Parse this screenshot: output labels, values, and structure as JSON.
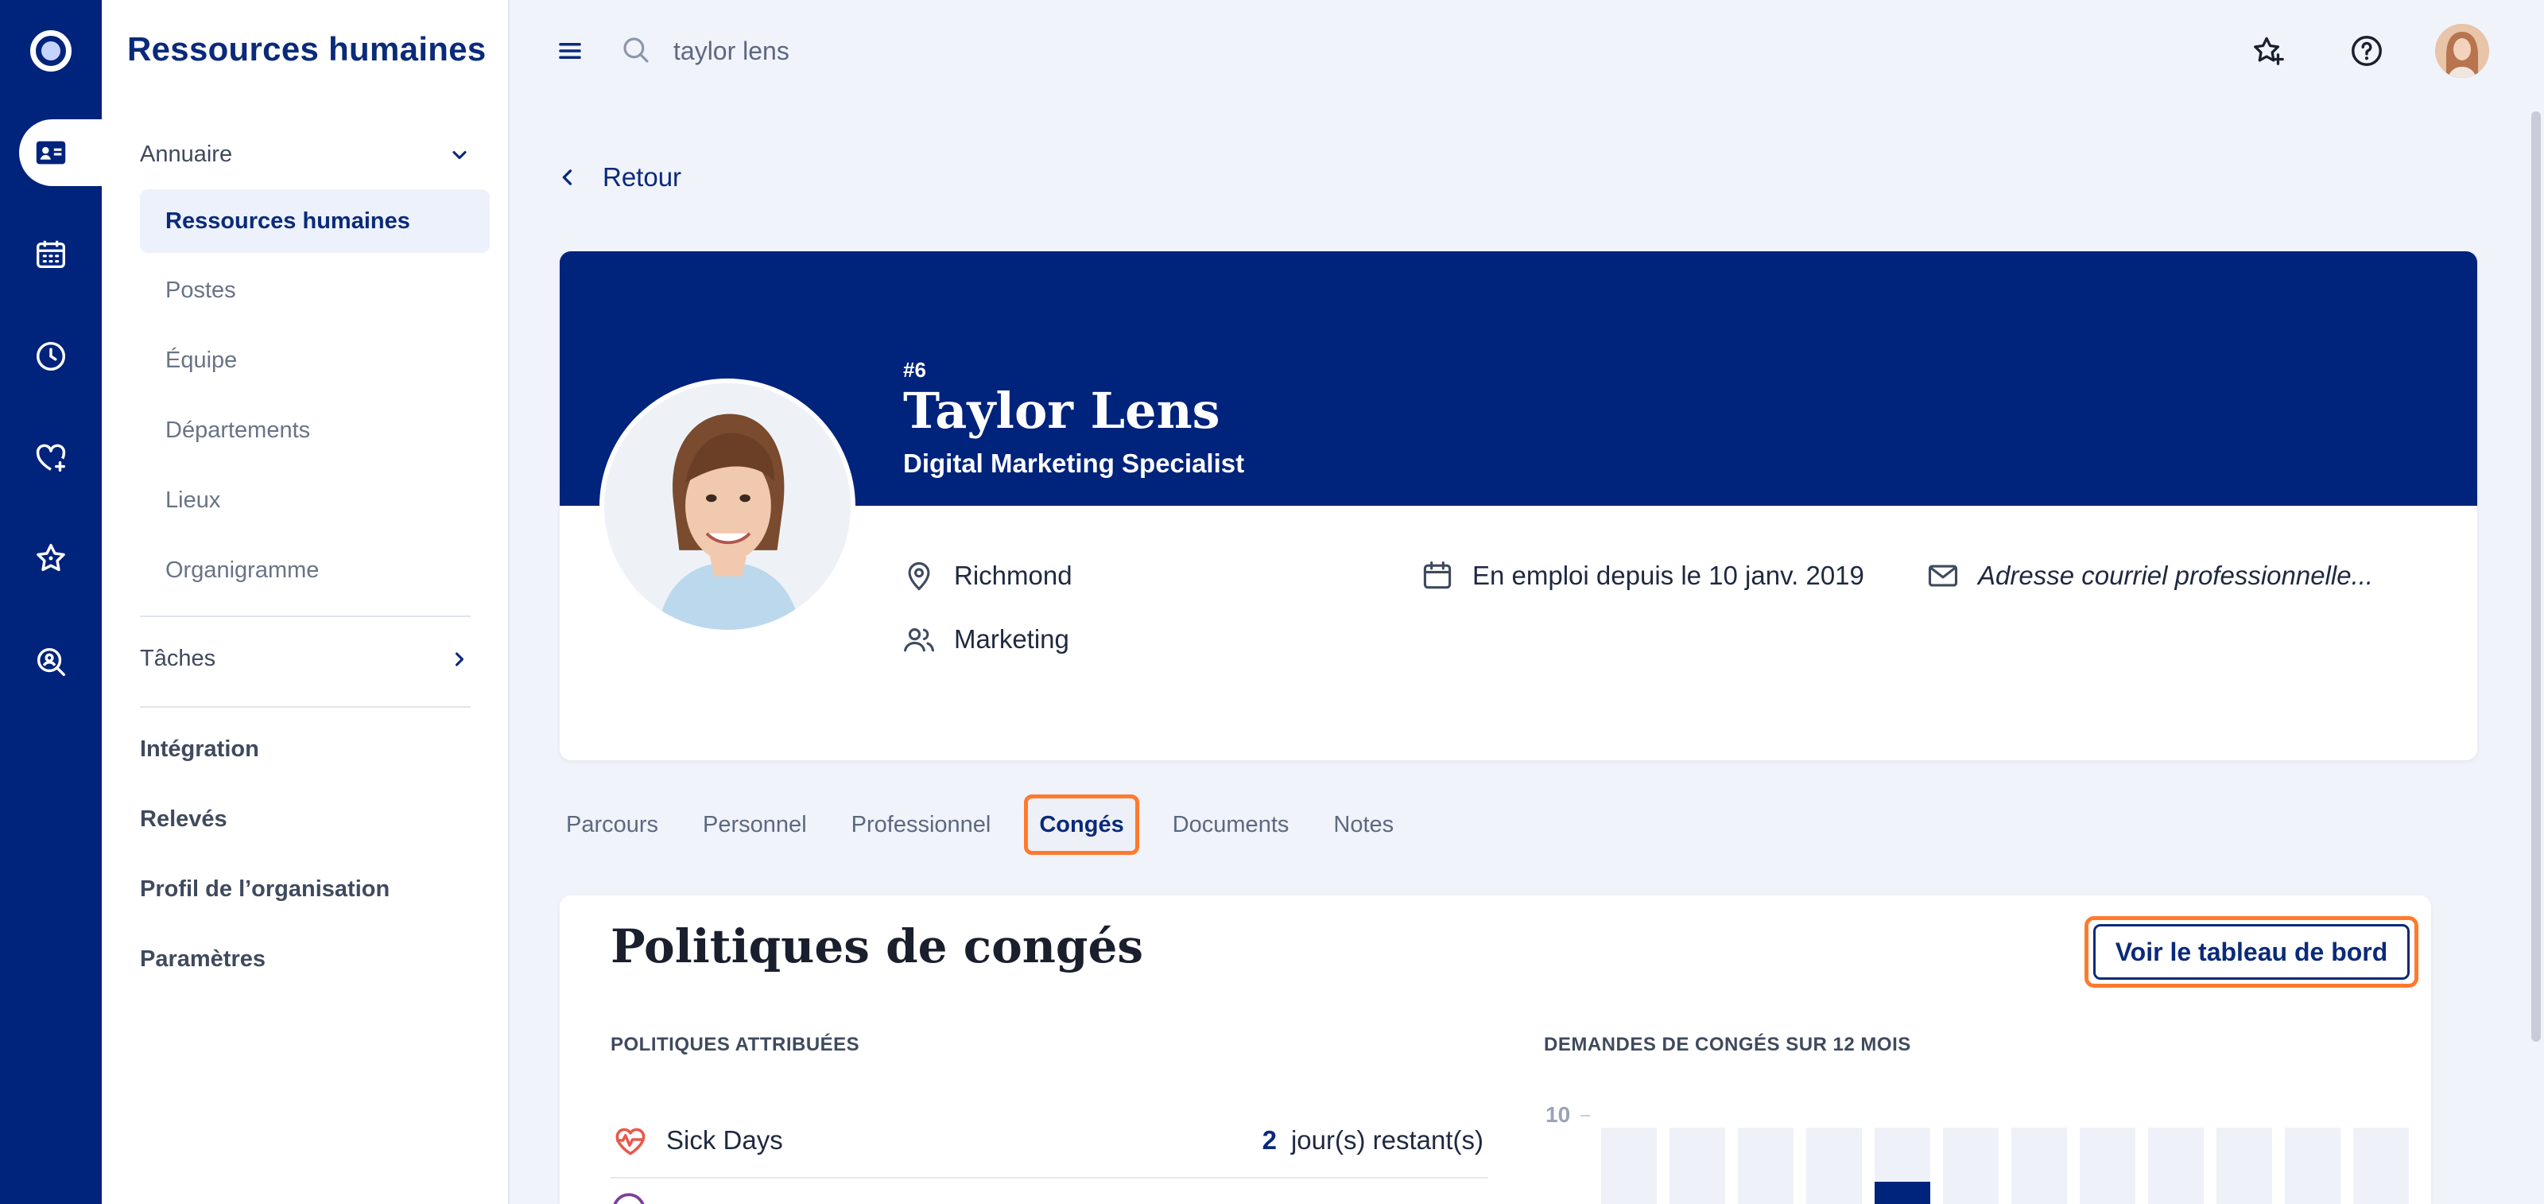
{
  "app": {
    "title": "Ressources humaines"
  },
  "search": {
    "value": "taylor lens"
  },
  "sidebar": {
    "groups": [
      {
        "label": "Annuaire"
      },
      {
        "label": "Tâches"
      }
    ],
    "directory_items": [
      {
        "label": "Ressources humaines",
        "active": true
      },
      {
        "label": "Postes"
      },
      {
        "label": "Équipe"
      },
      {
        "label": "Départements"
      },
      {
        "label": "Lieux"
      },
      {
        "label": "Organigramme"
      }
    ],
    "top_items": [
      {
        "label": "Intégration"
      },
      {
        "label": "Relevés"
      },
      {
        "label": "Profil de l’organisation"
      },
      {
        "label": "Paramètres"
      }
    ]
  },
  "rail_icons": [
    "logo-icon",
    "id-card-icon",
    "calendar-icon",
    "clock-icon",
    "heart-plus-icon",
    "star-icon",
    "search-person-icon"
  ],
  "back": {
    "label": "Retour"
  },
  "profile": {
    "id": "#6",
    "name": "Taylor Lens",
    "role": "Digital Marketing Specialist",
    "location": "Richmond",
    "department": "Marketing",
    "employed_since": "En emploi depuis le 10 janv. 2019",
    "email_placeholder": "Adresse courriel professionnelle..."
  },
  "tabs": [
    {
      "label": "Parcours"
    },
    {
      "label": "Personnel"
    },
    {
      "label": "Professionnel"
    },
    {
      "label": "Congés",
      "active": true
    },
    {
      "label": "Documents"
    },
    {
      "label": "Notes"
    }
  ],
  "policies": {
    "title": "Politiques de congés",
    "dashboard_button": "Voir le tableau de bord",
    "assigned_label": "POLITIQUES ATTRIBUÉES",
    "chart_label": "DEMANDES DE CONGÉS SUR 12 MOIS",
    "items": [
      {
        "name": "Sick Days",
        "count": "2",
        "unit": "jour(s) restant(s)"
      }
    ],
    "chart": {
      "y_tick": "10",
      "ymax": 10,
      "bars": [
        0,
        0,
        0,
        0,
        3,
        0,
        0,
        0,
        0,
        0,
        0,
        0
      ]
    }
  },
  "colors": {
    "brand": "#00237c",
    "accent": "#ff7a2e",
    "heart": "#e8584a"
  }
}
